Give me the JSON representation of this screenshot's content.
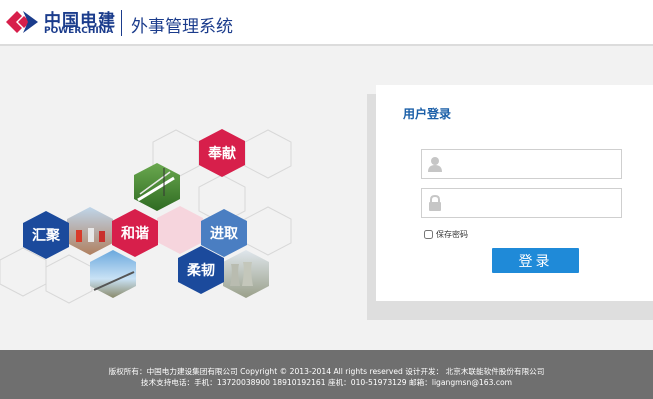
{
  "header": {
    "logo_cn": "中国电建",
    "logo_en": "POWERCHINA",
    "system_title": "外事管理系统"
  },
  "hexagons": {
    "fengxian": "奉献",
    "huiju": "汇聚",
    "hexie": "和谐",
    "jinqu": "进取",
    "rouren": "柔韧"
  },
  "login": {
    "title": "用户登录",
    "username_value": "",
    "password_value": "",
    "remember_label": "保存密码",
    "remember_checked": false,
    "submit_label": "登录"
  },
  "footer": {
    "line1": "版权所有：中国电力建设集团有限公司 Copyright © 2013-2014 All rights reserved 设计开发： 北京木联能软件股份有限公司",
    "line2": "技术支持电话：手机：13720038900 18910192161 座机：010-51973129 邮箱：ligangmsn@163.com"
  },
  "colors": {
    "brand_blue": "#1b3c8c",
    "brand_red": "#d71f4b",
    "button_blue": "#1f8ad8",
    "footer_gray": "#6f6f6f"
  }
}
